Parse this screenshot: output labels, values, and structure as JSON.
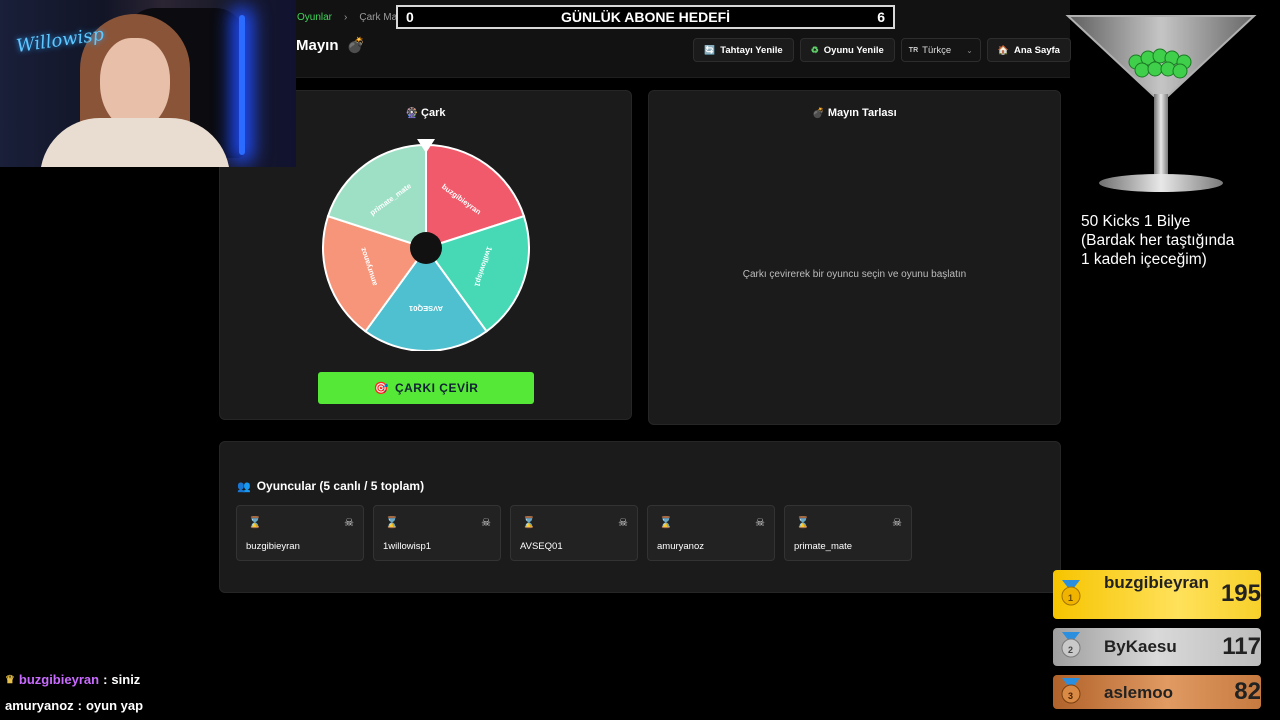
{
  "breadcrumb": {
    "parent": "Oyunlar",
    "separator": "›",
    "current": "Çark Mayın"
  },
  "page_title": "Mayın",
  "goal": {
    "left": "0",
    "title": "GÜNLÜK ABONE HEDEFİ",
    "right": "6"
  },
  "toolbar": {
    "refresh_board": "Tahtayı Yenile",
    "new_game": "Oyunu Yenile",
    "language_flag": "TR",
    "language": "Türkçe",
    "home": "Ana Sayfa"
  },
  "wheel": {
    "title": "Çark",
    "spin_label": "ÇARKI ÇEVİR",
    "segments": [
      {
        "name": "buzgibieyran",
        "color": "#f05a6a"
      },
      {
        "name": "1willowisp1",
        "color": "#47d9b6"
      },
      {
        "name": "AVSEQ01",
        "color": "#4ec0cf"
      },
      {
        "name": "amuryanoz",
        "color": "#f6957a"
      },
      {
        "name": "primate_mate",
        "color": "#9ee0c6"
      }
    ]
  },
  "minefield": {
    "title": "Mayın Tarlası",
    "hint": "Çarkı çevirerek bir oyuncu seçin ve oyunu başlatın"
  },
  "players": {
    "title": "Oyuncular (5 canlı / 5 toplam)",
    "list": [
      "buzgibieyran",
      "1willowisp1",
      "AVSEQ01",
      "amuryanoz",
      "primate_mate"
    ]
  },
  "webcam": {
    "logo": "Willowisp"
  },
  "overlay": {
    "line1": "50 Kicks 1 Bilye",
    "line2": "(Bardak her taştığında",
    "line3": "1 kadeh içeceğim)"
  },
  "leaderboard": [
    {
      "rank": "1",
      "name": "buzgibieyran",
      "score": "195"
    },
    {
      "rank": "2",
      "name": "ByKaesu",
      "score": "117"
    },
    {
      "rank": "3",
      "name": "aslemoo",
      "score": "82"
    }
  ],
  "chat": [
    {
      "user": "buzgibieyran",
      "sep": ":",
      "message": "siniz"
    },
    {
      "user": "amuryanoz",
      "sep": ":",
      "message": "oyun yap"
    }
  ]
}
